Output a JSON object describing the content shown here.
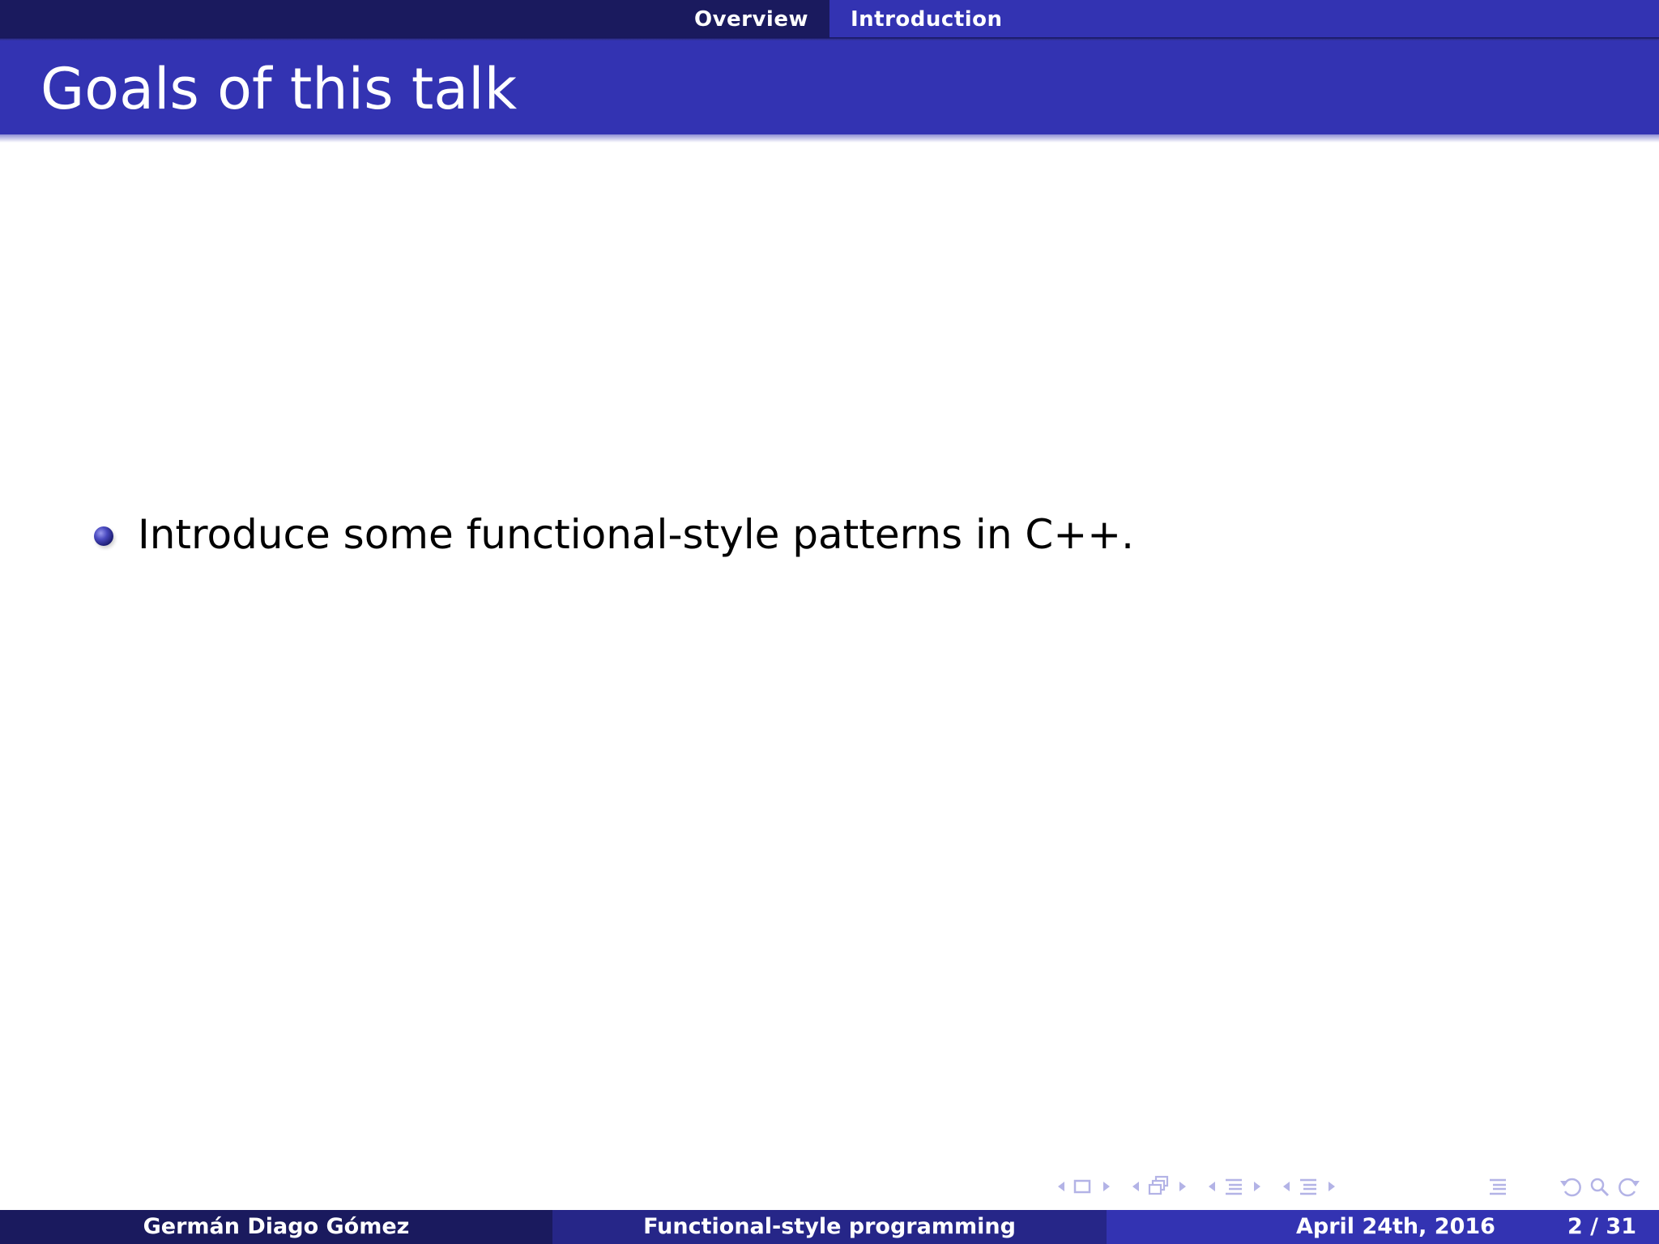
{
  "header": {
    "sections": [
      {
        "label": "Overview",
        "active": false
      },
      {
        "label": "Introduction",
        "active": true
      }
    ]
  },
  "frame": {
    "title": "Goals of this talk",
    "bullets": [
      "Introduce some functional-style patterns in C++."
    ]
  },
  "navigation_symbols": [
    {
      "name": "prev-slide-icon"
    },
    {
      "name": "slide-icon"
    },
    {
      "name": "next-slide-icon"
    },
    {
      "name": "prev-frame-icon"
    },
    {
      "name": "frame-icon"
    },
    {
      "name": "next-frame-icon"
    },
    {
      "name": "prev-subsection-icon"
    },
    {
      "name": "subsection-icon"
    },
    {
      "name": "next-subsection-icon"
    },
    {
      "name": "prev-section-icon"
    },
    {
      "name": "section-icon"
    },
    {
      "name": "next-section-icon"
    },
    {
      "name": "document-icon"
    },
    {
      "name": "back-icon"
    },
    {
      "name": "search-icon"
    },
    {
      "name": "forward-icon"
    }
  ],
  "footer": {
    "author": "Germán Diago Gómez",
    "title": "Functional-style programming",
    "date": "April 24th, 2016",
    "page": "2 / 31"
  },
  "colors": {
    "nav_dark": "#1a1a5e",
    "accent": "#3333b2",
    "footer_mid": "#262688",
    "symbols": "#b3b3e6"
  }
}
